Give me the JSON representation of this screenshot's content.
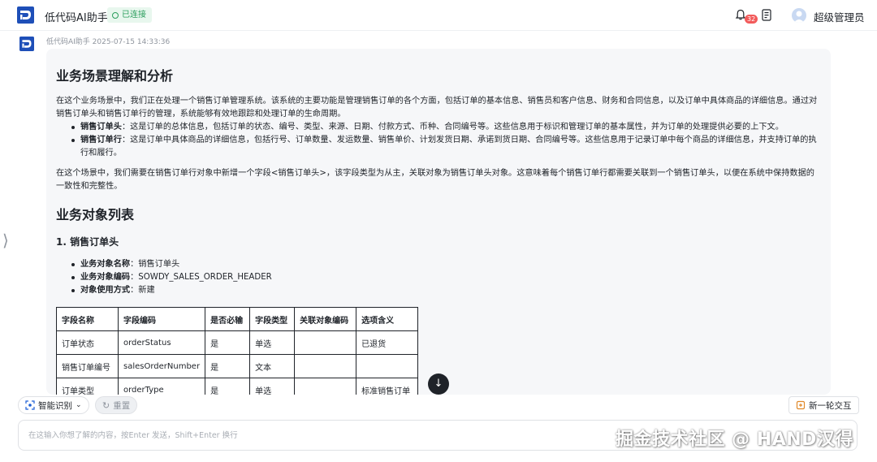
{
  "header": {
    "app_title": "低代码AI助手",
    "status": "已连接",
    "notification_count": "32",
    "user_name": "超级管理员"
  },
  "message": {
    "meta": "低代码AI助手 2025-07-15 14:33:36",
    "heading1": "业务场景理解和分析",
    "intro": "在这个业务场景中，我们正在处理一个销售订单管理系统。该系统的主要功能是管理销售订单的各个方面，包括订单的基本信息、销售员和客户信息、财务和合同信息，以及订单中具体商品的详细信息。通过对销售订单头和销售订单行的管理，系统能够有效地跟踪和处理订单的生命周期。",
    "bullets": [
      {
        "term": "销售订单头",
        "text": "：这是订单的总体信息，包括订单的状态、编号、类型、来源、日期、付款方式、币种、合同编号等。这些信息用于标识和管理订单的基本属性，并为订单的处理提供必要的上下文。"
      },
      {
        "term": "销售订单行",
        "text": "：这是订单中具体商品的详细信息，包括行号、订单数量、发运数量、销售单价、计划发货日期、承诺到货日期、合同编号等。这些信息用于记录订单中每个商品的详细信息，并支持订单的执行和履行。"
      }
    ],
    "scenario": "在这个场景中，我们需要在销售订单行对象中新增一个字段<销售订单头>，该字段类型为从主，关联对象为销售订单头对象。这意味着每个销售订单行都需要关联到一个销售订单头，以便在系统中保持数据的一致性和完整性。",
    "heading2": "业务对象列表",
    "object_title": "1. 销售订单头",
    "object_props": [
      {
        "term": "业务对象名称",
        "text": "：销售订单头"
      },
      {
        "term": "业务对象编码",
        "text": "：SOWDY_SALES_ORDER_HEADER"
      },
      {
        "term": "对象使用方式",
        "text": "：新建"
      }
    ],
    "table": {
      "headers": [
        "字段名称",
        "字段编码",
        "是否必输",
        "字段类型",
        "关联对象编码",
        "选项含义"
      ],
      "rows": [
        [
          "订单状态",
          "orderStatus",
          "是",
          "单选",
          "",
          "已退货"
        ],
        [
          "销售订单编号",
          "salesOrderNumber",
          "是",
          "文本",
          "",
          ""
        ],
        [
          "订单类型",
          "orderType",
          "是",
          "单选",
          "",
          "标准销售订单"
        ]
      ]
    }
  },
  "footer": {
    "smart_recognition": "智能识别",
    "reset": "重置",
    "new_round": "新一轮交互",
    "input_placeholder": "在这输入你想了解的内容，按Enter 发送，Shift+Enter 换行",
    "watermark": "掘金技术社区 @ HAND汉得"
  },
  "colors": {
    "accent": "#1e5fd6",
    "status_green": "#2a9d5c",
    "badge_red": "#f25a5a"
  }
}
